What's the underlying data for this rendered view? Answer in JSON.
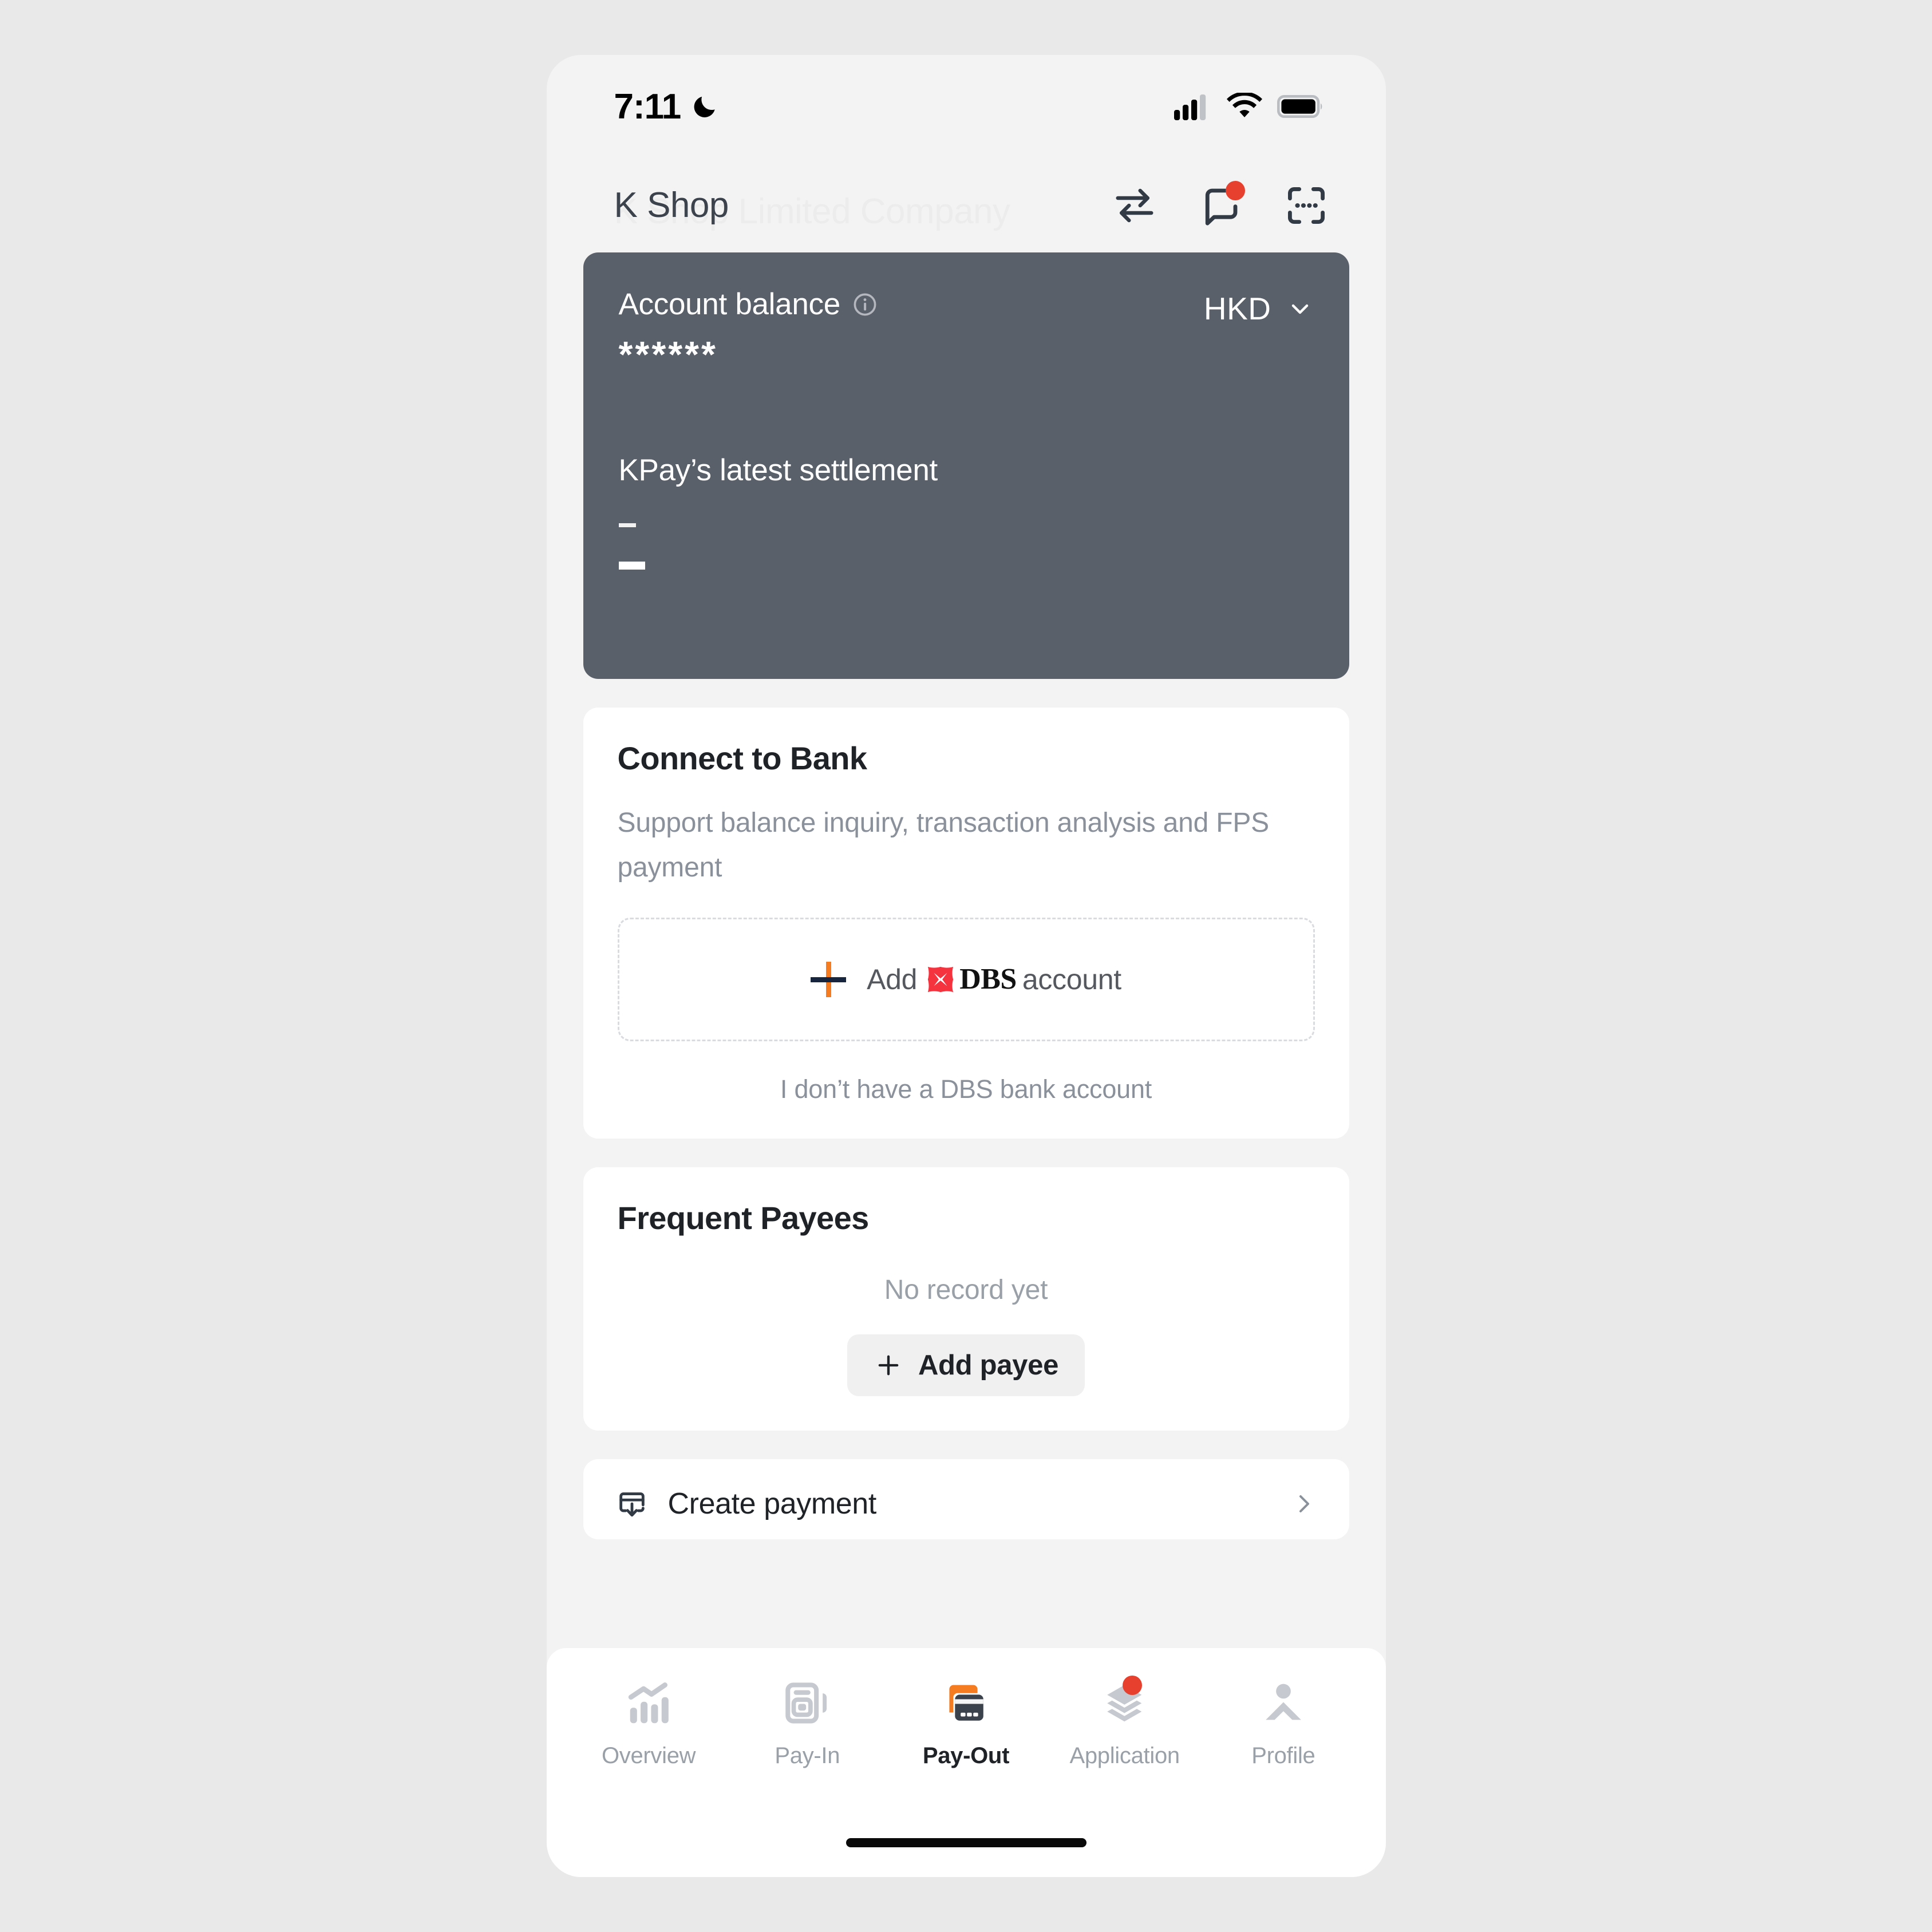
{
  "status_bar": {
    "time": "7:11",
    "moon_icon": "moon-icon",
    "signal_icon": "cellular-signal-icon",
    "wifi_icon": "wifi-icon",
    "battery_icon": "battery-full-icon"
  },
  "header": {
    "title": "K Shop",
    "ghost_title": "K Shop Limited Company",
    "transfer_icon": "transfer-arrows-icon",
    "chat_icon": "chat-bubble-icon",
    "scan_icon": "scan-frame-icon",
    "chat_has_badge": true
  },
  "balance_card": {
    "label": "Account balance",
    "info_icon": "info-circle-icon",
    "currency": "HKD",
    "currency_chevron_icon": "chevron-down-icon",
    "amount_masked": "******",
    "settlement_label": "KPay’s latest settlement",
    "settlement_date": "–",
    "settlement_amount": "—",
    "background_color": "#5a6069"
  },
  "connect_to_bank": {
    "title": "Connect to Bank",
    "subtitle": "Support balance inquiry, transaction analysis and FPS payment",
    "add_account": {
      "plus_icon": "plus-icon",
      "prefix": "Add",
      "bank_logo_icon": "dbs-logo-icon",
      "bank_name": "DBS",
      "suffix": "account"
    },
    "no_account_link": "I don’t have a DBS bank account",
    "plus_vertical_color": "#f57c20",
    "plus_horizontal_color": "#17253f",
    "dbs_logo_color": "#f5333f"
  },
  "frequent_payees": {
    "title": "Frequent Payees",
    "empty_text": "No record yet",
    "add_button_label": "Add payee",
    "add_button_icon": "plus-icon"
  },
  "create_payment": {
    "label": "Create payment",
    "icon": "card-download-icon",
    "chevron_icon": "chevron-right-icon"
  },
  "bottom_nav": {
    "items": [
      {
        "label": "Overview",
        "icon": "bar-chart-trend-icon",
        "active": false,
        "badge": false
      },
      {
        "label": "Pay-In",
        "icon": "card-reader-icon",
        "active": false,
        "badge": false
      },
      {
        "label": "Pay-Out",
        "icon": "cards-stack-icon",
        "active": true,
        "badge": false
      },
      {
        "label": "Application",
        "icon": "layers-icon",
        "active": false,
        "badge": true
      },
      {
        "label": "Profile",
        "icon": "person-icon",
        "active": false,
        "badge": false
      }
    ],
    "active_accent_color": "#f57c20",
    "badge_color": "#e8402e",
    "inactive_color": "#c6c9cf"
  }
}
